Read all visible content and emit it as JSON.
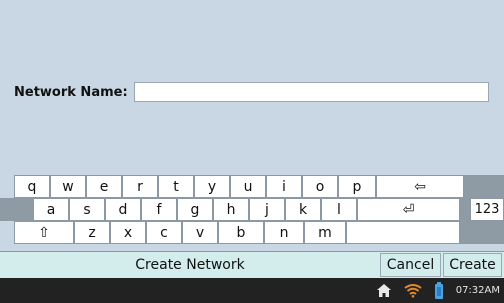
{
  "form": {
    "label": "Network Name:",
    "value": "",
    "placeholder": ""
  },
  "keyboard": {
    "row1": [
      "q",
      "w",
      "e",
      "r",
      "t",
      "y",
      "u",
      "i",
      "o",
      "p",
      "⇦"
    ],
    "row2": [
      "a",
      "s",
      "d",
      "f",
      "g",
      "h",
      "j",
      "k",
      "l",
      "⏎"
    ],
    "row3": [
      "⇧",
      "z",
      "x",
      "c",
      "v",
      "b",
      "n",
      "m"
    ],
    "numeric_label": "123"
  },
  "actions": {
    "create_network": "Create Network",
    "cancel": "Cancel",
    "create": "Create"
  },
  "status": {
    "time": "07:32AM"
  }
}
